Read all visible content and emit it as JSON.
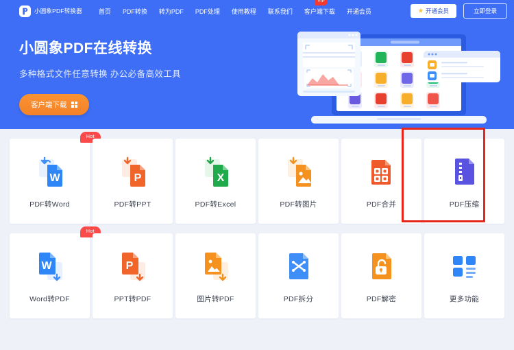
{
  "navbar": {
    "brand_name": "小圆象PDF转换器",
    "brand_logo_icon": "pdf-logo-icon",
    "menu": [
      {
        "label": "首页",
        "badge": null
      },
      {
        "label": "PDF转换",
        "badge": null
      },
      {
        "label": "转为PDF",
        "badge": null
      },
      {
        "label": "PDF处理",
        "badge": null
      },
      {
        "label": "使用教程",
        "badge": null
      },
      {
        "label": "联系我们",
        "badge": null
      },
      {
        "label": "客户端下载",
        "badge": "VIP"
      },
      {
        "label": "开通会员",
        "badge": null
      }
    ],
    "vip_button": {
      "label": "开通会员",
      "icon": "star-icon"
    },
    "login_button": {
      "label": "立即登录"
    }
  },
  "hero": {
    "title": "小圆象PDF在线转换",
    "subtitle": "多种格式文件任意转换 办公必备高效工具",
    "cta": {
      "label": "客户端下载",
      "icon": "windows-icon"
    },
    "illustration_name": "laptop-apps-illustration"
  },
  "tools": {
    "rows": [
      [
        {
          "label": "PDF转Word",
          "icon": "word-doc-icon",
          "badge": "Hot",
          "highlighted": false
        },
        {
          "label": "PDF转PPT",
          "icon": "ppt-doc-icon",
          "badge": null,
          "highlighted": false
        },
        {
          "label": "PDF转Excel",
          "icon": "excel-doc-icon",
          "badge": null,
          "highlighted": false
        },
        {
          "label": "PDF转图片",
          "icon": "image-doc-icon",
          "badge": null,
          "highlighted": false
        },
        {
          "label": "PDF合并",
          "icon": "merge-doc-icon",
          "badge": null,
          "highlighted": false
        },
        {
          "label": "PDF压缩",
          "icon": "compress-doc-icon",
          "badge": null,
          "highlighted": true
        }
      ],
      [
        {
          "label": "Word转PDF",
          "icon": "word-to-pdf-icon",
          "badge": "Hot",
          "highlighted": false
        },
        {
          "label": "PPT转PDF",
          "icon": "ppt-to-pdf-icon",
          "badge": null,
          "highlighted": false
        },
        {
          "label": "图片转PDF",
          "icon": "image-to-pdf-icon",
          "badge": null,
          "highlighted": false
        },
        {
          "label": "PDF拆分",
          "icon": "split-doc-icon",
          "badge": null,
          "highlighted": false
        },
        {
          "label": "PDF解密",
          "icon": "unlock-doc-icon",
          "badge": null,
          "highlighted": false
        },
        {
          "label": "更多功能",
          "icon": "more-grid-icon",
          "badge": null,
          "highlighted": false
        }
      ]
    ]
  },
  "colors": {
    "brand_blue": "#3d6ef5",
    "page_bg": "#eef1f8",
    "cta_orange": "#f4812a",
    "badge_red": "#fb4a49",
    "highlight_red": "#e8251a"
  }
}
